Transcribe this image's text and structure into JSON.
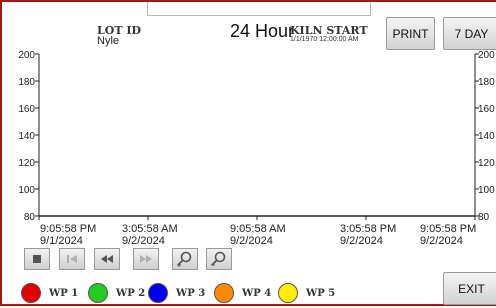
{
  "header": {
    "lot_id_label": "LOT ID",
    "lot_id_value": "Nyle",
    "duration": "24 Hour",
    "kiln_start_label": "KILN START",
    "kiln_start_time": "1/1/1970 12:00:00 AM"
  },
  "buttons": {
    "print": "PRINT",
    "days": "7 DAY",
    "exit": "EXIT"
  },
  "chart_data": {
    "type": "line",
    "y_ticks_left": [
      "200",
      "180",
      "160",
      "140",
      "120",
      "100",
      "80"
    ],
    "y_ticks_right": [
      "200",
      "180",
      "160",
      "140",
      "120",
      "100",
      "80"
    ],
    "ylim": [
      80,
      200
    ],
    "x_ticks": [
      {
        "time": "9:05:58 PM",
        "date": "9/1/2024"
      },
      {
        "time": "3:05:58 AM",
        "date": "9/2/2024"
      },
      {
        "time": "9:05:58 AM",
        "date": "9/2/2024"
      },
      {
        "time": "3:05:58 PM",
        "date": "9/2/2024"
      },
      {
        "time": "9:05:58 PM",
        "date": "9/2/2024"
      }
    ],
    "series": []
  },
  "legend": [
    {
      "label": "WP 1",
      "color": "#e60000"
    },
    {
      "label": "WP 2",
      "color": "#22cc22"
    },
    {
      "label": "WP 3",
      "color": "#0000ee"
    },
    {
      "label": "WP 4",
      "color": "#ff8800"
    },
    {
      "label": "WP 5",
      "color": "#ffee00"
    }
  ],
  "nav_icons": [
    "stop-icon",
    "skip-to-start-icon",
    "rewind-icon",
    "fast-forward-icon",
    "zoom-in-icon",
    "zoom-out-icon"
  ]
}
